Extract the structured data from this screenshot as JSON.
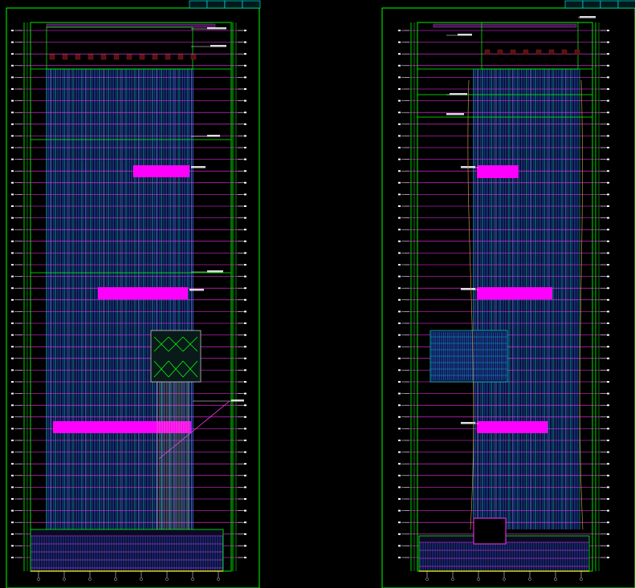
{
  "sheets": [
    {
      "id": "left",
      "title_block": [
        "",
        "",
        "",
        ""
      ],
      "colors": {
        "frame": "#00ff00",
        "mullion": "#2f63ff",
        "level": "#ff33ff",
        "column": "#00ffff",
        "band": "#ff00ff",
        "yellow": "#ffff00",
        "annot": "#ffffff"
      }
    },
    {
      "id": "right",
      "title_block": [
        "",
        "",
        "",
        ""
      ],
      "colors": {
        "frame": "#00ff00",
        "mullion": "#2f63ff",
        "level": "#ff33ff",
        "column": "#00ffff",
        "band": "#ff00ff",
        "yellow": "#ffff00",
        "annot": "#ffffff"
      }
    }
  ]
}
